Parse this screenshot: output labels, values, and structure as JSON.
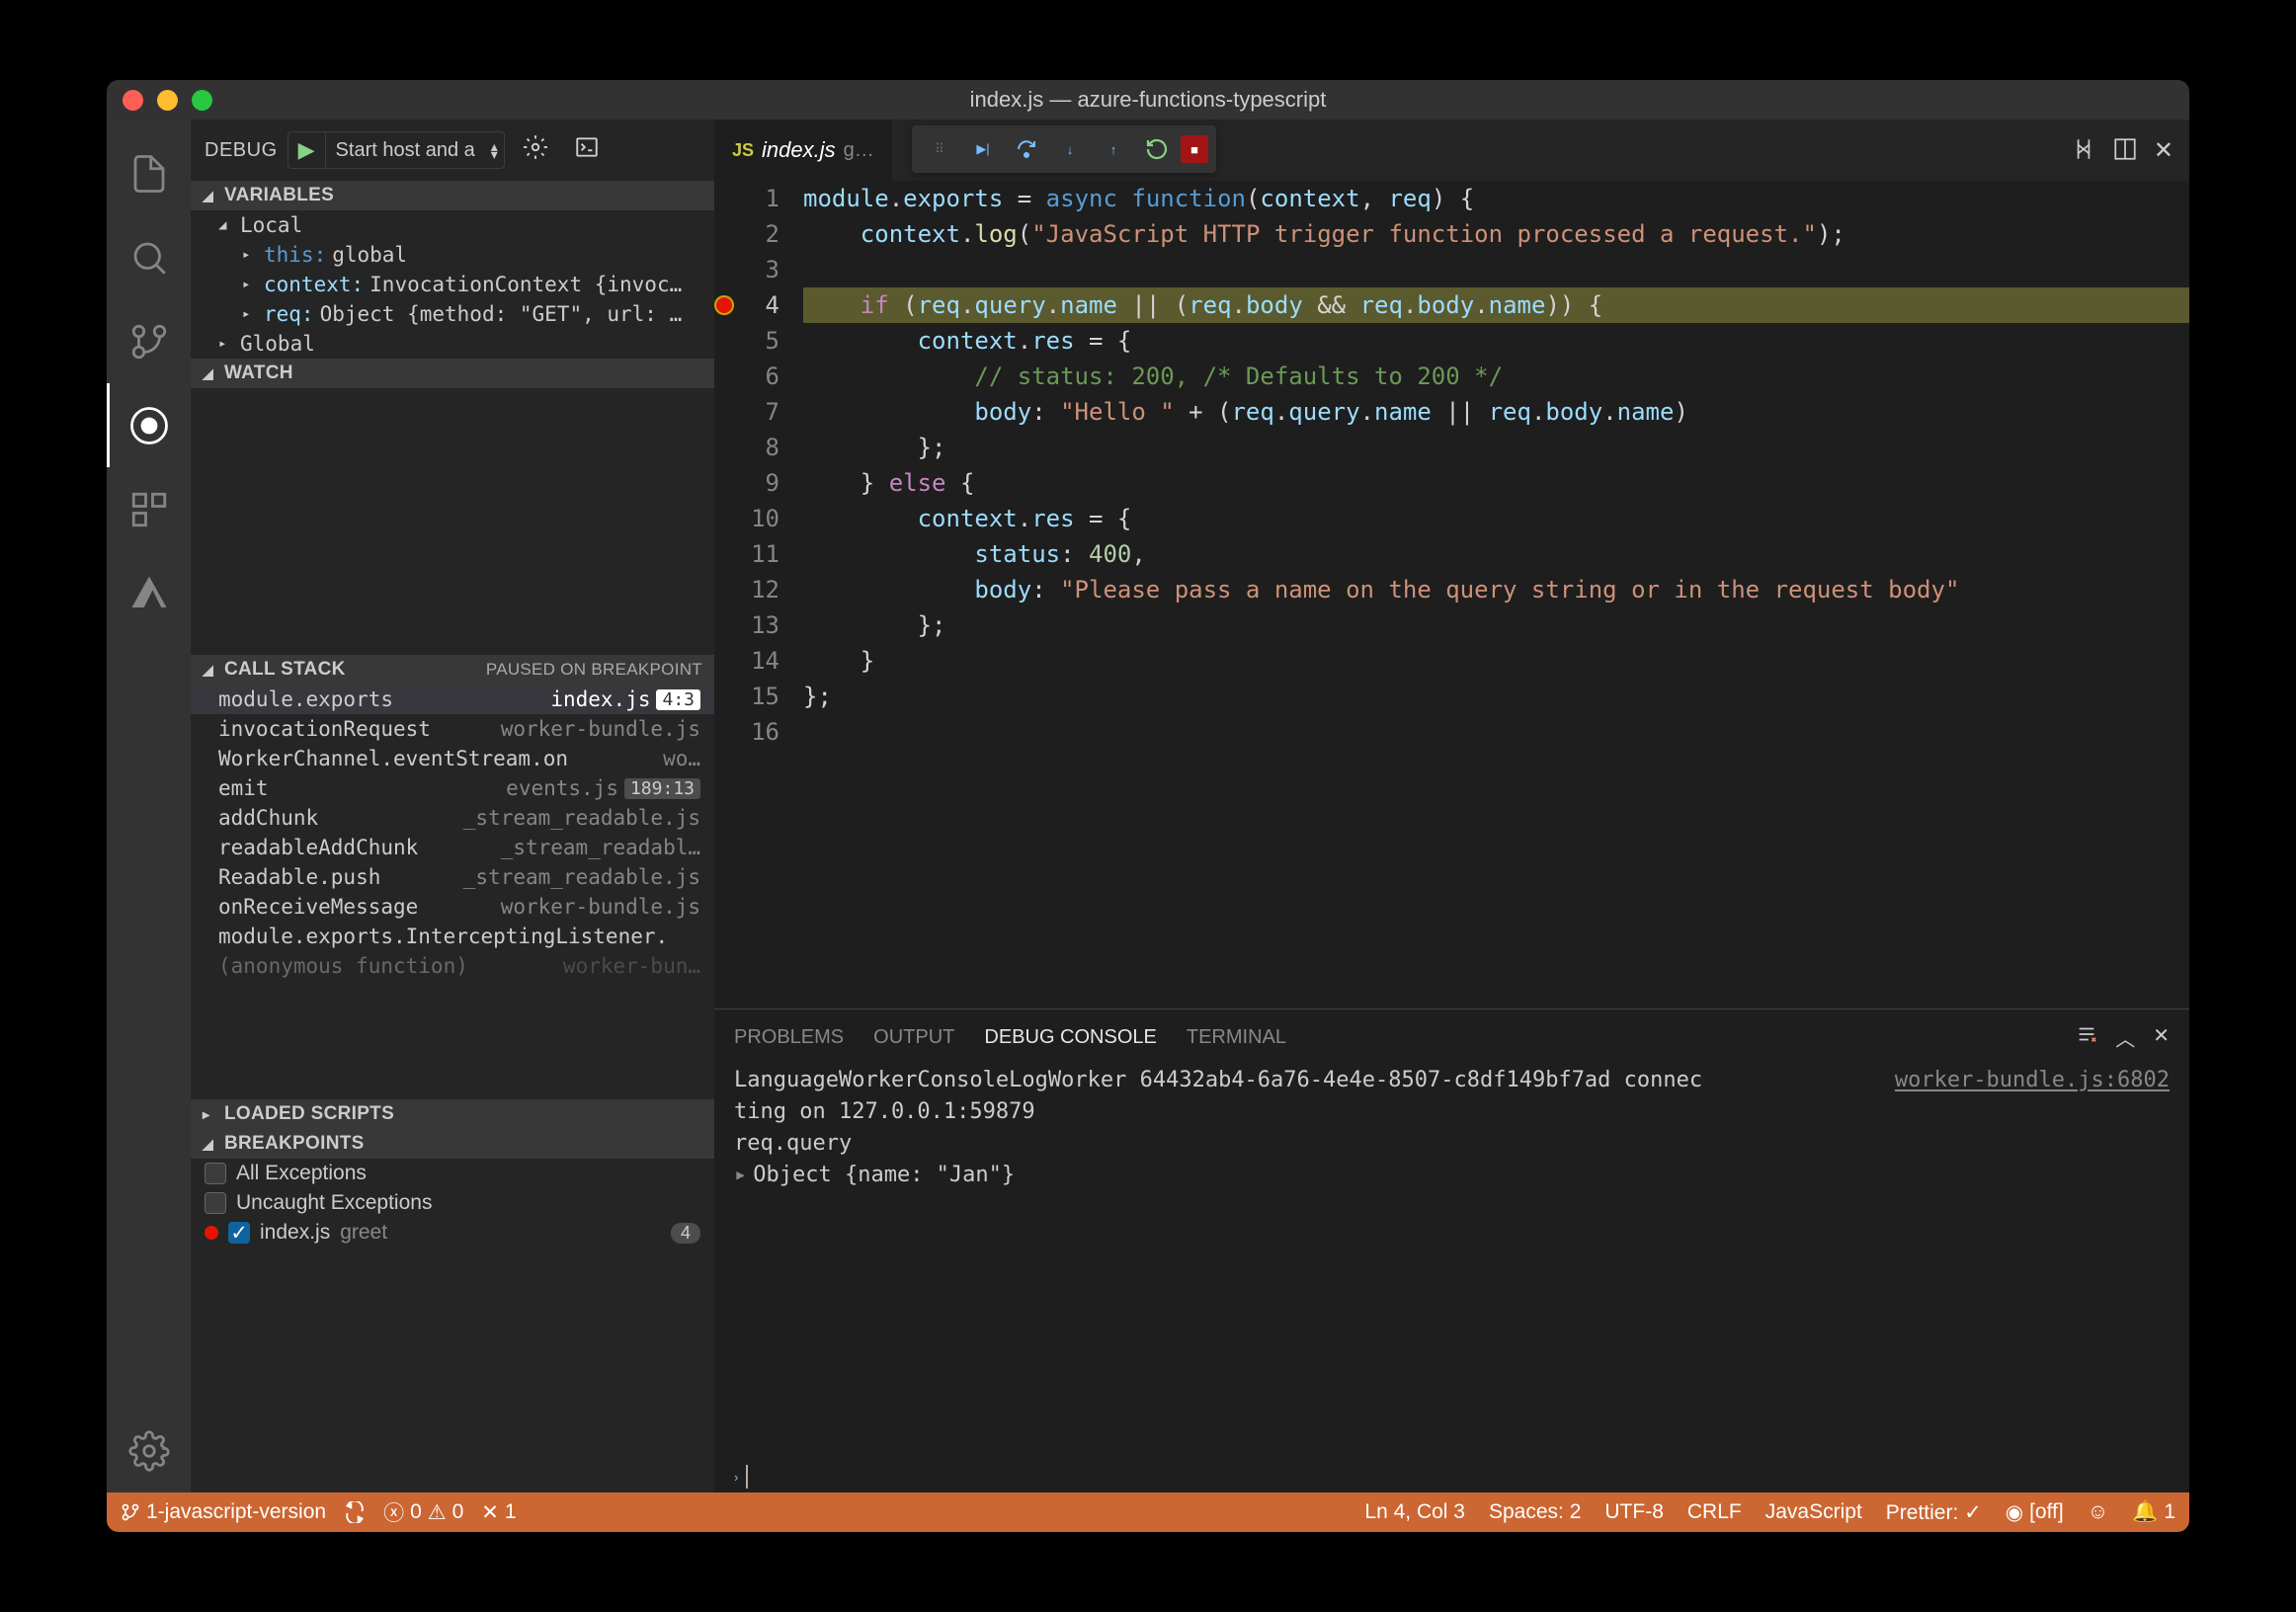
{
  "title": "index.js — azure-functions-typescript",
  "debug": {
    "title": "DEBUG",
    "config": "Start host and a"
  },
  "variables": {
    "header": "VARIABLES",
    "local": "Local",
    "global": "Global",
    "items": [
      {
        "key": "this:",
        "val": "global"
      },
      {
        "key": "context:",
        "val": "InvocationContext {invoc…"
      },
      {
        "key": "req:",
        "val": "Object {method: \"GET\", url: …"
      }
    ]
  },
  "watch": {
    "header": "WATCH"
  },
  "callstack": {
    "header": "CALL STACK",
    "status": "PAUSED ON BREAKPOINT",
    "frames": [
      {
        "fn": "module.exports",
        "file": "index.js",
        "loc": "4:3"
      },
      {
        "fn": "invocationRequest",
        "file": "worker-bundle.js"
      },
      {
        "fn": "WorkerChannel.eventStream.on",
        "file": "wo…"
      },
      {
        "fn": "emit",
        "file": "events.js",
        "loc": "189:13"
      },
      {
        "fn": "addChunk",
        "file": "_stream_readable.js"
      },
      {
        "fn": "readableAddChunk",
        "file": "_stream_readabl…"
      },
      {
        "fn": "Readable.push",
        "file": "_stream_readable.js"
      },
      {
        "fn": "onReceiveMessage",
        "file": "worker-bundle.js"
      },
      {
        "fn": "module.exports.InterceptingListener.",
        "file": ""
      },
      {
        "fn": "(anonymous function)",
        "file": "worker-bun…"
      }
    ]
  },
  "loadedScripts": {
    "header": "LOADED SCRIPTS"
  },
  "breakpoints": {
    "header": "BREAKPOINTS",
    "all": "All Exceptions",
    "uncaught": "Uncaught Exceptions",
    "bp_file": "index.js",
    "bp_fn": "greet",
    "bp_count": "4"
  },
  "editor": {
    "tab_name": "index.js",
    "tab_suffix": "g…",
    "lines": 16,
    "current_line": 4
  },
  "panel": {
    "tabs": [
      "PROBLEMS",
      "OUTPUT",
      "DEBUG CONSOLE",
      "TERMINAL"
    ],
    "active": 2,
    "console_msg1": "LanguageWorkerConsoleLogWorker 64432ab4-6a76-4e4e-8507-c8df149bf7ad connec",
    "console_msg2": "ting on 127.0.0.1:59879",
    "console_src": "worker-bundle.js:6802",
    "console_expr": "req.query",
    "console_result": "Object {name: \"Jan\"}"
  },
  "statusbar": {
    "branch": "1-javascript-version",
    "errors": "0",
    "warnings": "0",
    "ports": "1",
    "ln_col": "Ln 4, Col 3",
    "spaces": "Spaces: 2",
    "encoding": "UTF-8",
    "eol": "CRLF",
    "lang": "JavaScript",
    "prettier": "Prettier: ✓",
    "screencast": "[off]",
    "bell": "1"
  }
}
